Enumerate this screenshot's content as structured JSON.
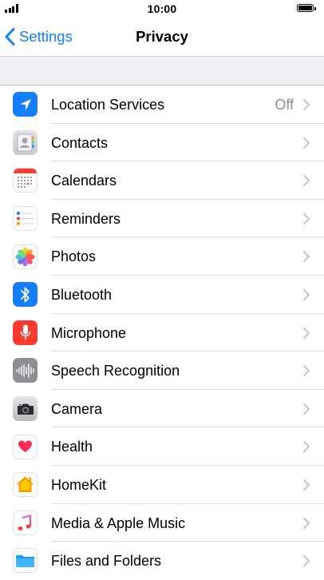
{
  "status": {
    "time": "10:00"
  },
  "nav": {
    "back_label": "Settings",
    "title": "Privacy"
  },
  "items": [
    {
      "label": "Location Services",
      "value": "Off",
      "icon": "location-arrow-icon",
      "color": "#157efb"
    },
    {
      "label": "Contacts",
      "value": "",
      "icon": "contacts-icon",
      "color": "#c9c9ce"
    },
    {
      "label": "Calendars",
      "value": "",
      "icon": "calendar-icon",
      "color": "#ff3b30"
    },
    {
      "label": "Reminders",
      "value": "",
      "icon": "reminders-icon",
      "color": "#ffffff"
    },
    {
      "label": "Photos",
      "value": "",
      "icon": "photos-icon",
      "color": "#ffffff"
    },
    {
      "label": "Bluetooth",
      "value": "",
      "icon": "bluetooth-icon",
      "color": "#157efb"
    },
    {
      "label": "Microphone",
      "value": "",
      "icon": "microphone-icon",
      "color": "#ff3b30"
    },
    {
      "label": "Speech Recognition",
      "value": "",
      "icon": "speech-waveform-icon",
      "color": "#8e8e93"
    },
    {
      "label": "Camera",
      "value": "",
      "icon": "camera-icon",
      "color": "#c7c7cc"
    },
    {
      "label": "Health",
      "value": "",
      "icon": "heart-icon",
      "color": "#ff2d55"
    },
    {
      "label": "HomeKit",
      "value": "",
      "icon": "home-icon",
      "color": "#ff9500"
    },
    {
      "label": "Media & Apple Music",
      "value": "",
      "icon": "music-note-icon",
      "color": "#fc3c44"
    },
    {
      "label": "Files and Folders",
      "value": "",
      "icon": "folder-icon",
      "color": "#1a9cf2"
    }
  ]
}
